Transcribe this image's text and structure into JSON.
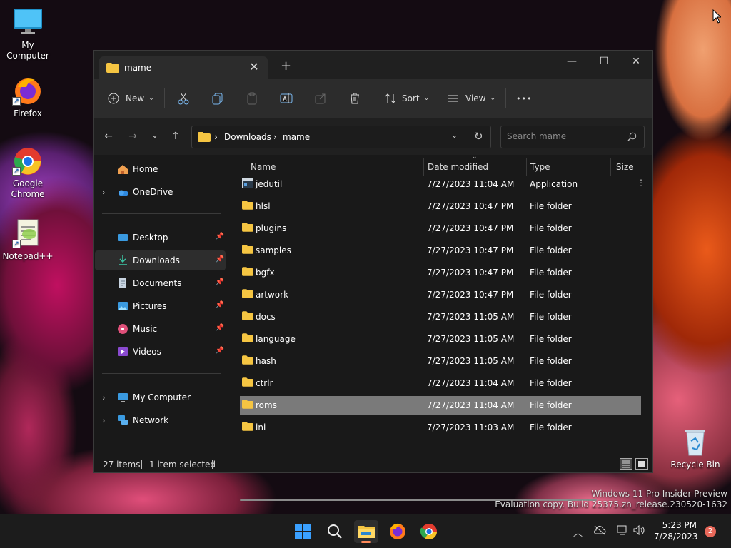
{
  "desktop": {
    "icons": [
      {
        "label": "My Computer",
        "icon": "monitor-icon"
      },
      {
        "label": "Firefox",
        "icon": "firefox-icon"
      },
      {
        "label": "Google Chrome",
        "icon": "chrome-icon"
      },
      {
        "label": "Notepad++",
        "icon": "notepadpp-icon"
      },
      {
        "label": "Recycle Bin",
        "icon": "recycle-bin-icon"
      }
    ],
    "watermark_line1": "Windows 11 Pro Insider Preview",
    "watermark_line2": "Evaluation copy. Build 25375.zn_release.230520-1632"
  },
  "window": {
    "tab_title": "mame",
    "tab_close": "✕",
    "new_tab": "+",
    "controls": {
      "minimize": "—",
      "maximize": "☐",
      "close": "✕"
    }
  },
  "toolbar": {
    "new_label": "New",
    "sort_label": "Sort",
    "view_label": "View",
    "more_label": "•••"
  },
  "address": {
    "segments": [
      "Downloads",
      "mame"
    ],
    "separator": "›"
  },
  "search": {
    "placeholder": "Search mame"
  },
  "nav": {
    "items": [
      {
        "label": "Home",
        "icon": "home-icon"
      },
      {
        "label": "OneDrive",
        "icon": "onedrive-icon"
      },
      {
        "label": "Desktop",
        "icon": "desktop-icon"
      },
      {
        "label": "Downloads",
        "icon": "downloads-icon"
      },
      {
        "label": "Documents",
        "icon": "documents-icon"
      },
      {
        "label": "Pictures",
        "icon": "pictures-icon"
      },
      {
        "label": "Music",
        "icon": "music-icon"
      },
      {
        "label": "Videos",
        "icon": "videos-icon"
      },
      {
        "label": "My Computer",
        "icon": "my-computer-icon"
      },
      {
        "label": "Network",
        "icon": "network-icon"
      }
    ],
    "selected": "Downloads"
  },
  "files": {
    "columns": {
      "name": "Name",
      "date": "Date modified",
      "type": "Type",
      "size": "Size"
    },
    "rows": [
      {
        "name": "jedutil",
        "date": "7/27/2023 11:04 AM",
        "type": "Application"
      },
      {
        "name": "hlsl",
        "date": "7/27/2023 10:47 PM",
        "type": "File folder"
      },
      {
        "name": "plugins",
        "date": "7/27/2023 10:47 PM",
        "type": "File folder"
      },
      {
        "name": "samples",
        "date": "7/27/2023 10:47 PM",
        "type": "File folder"
      },
      {
        "name": "bgfx",
        "date": "7/27/2023 10:47 PM",
        "type": "File folder"
      },
      {
        "name": "artwork",
        "date": "7/27/2023 10:47 PM",
        "type": "File folder"
      },
      {
        "name": "docs",
        "date": "7/27/2023 11:05 AM",
        "type": "File folder"
      },
      {
        "name": "language",
        "date": "7/27/2023 11:05 AM",
        "type": "File folder"
      },
      {
        "name": "hash",
        "date": "7/27/2023 11:05 AM",
        "type": "File folder"
      },
      {
        "name": "ctrlr",
        "date": "7/27/2023 11:04 AM",
        "type": "File folder"
      },
      {
        "name": "roms",
        "date": "7/27/2023 11:04 AM",
        "type": "File folder"
      },
      {
        "name": "ini",
        "date": "7/27/2023 11:03 AM",
        "type": "File folder"
      }
    ],
    "selected": "roms"
  },
  "status": {
    "item_count": "27 items",
    "selection": "1 item selected"
  },
  "taskbar": {
    "time": "5:23 PM",
    "date": "7/28/2023",
    "notifications": "2"
  },
  "colors": {
    "folder": "#f5c542",
    "selected_row": "#7a7a7a",
    "window_bg": "#191919",
    "toolbar_bg": "#2c2c2c"
  }
}
